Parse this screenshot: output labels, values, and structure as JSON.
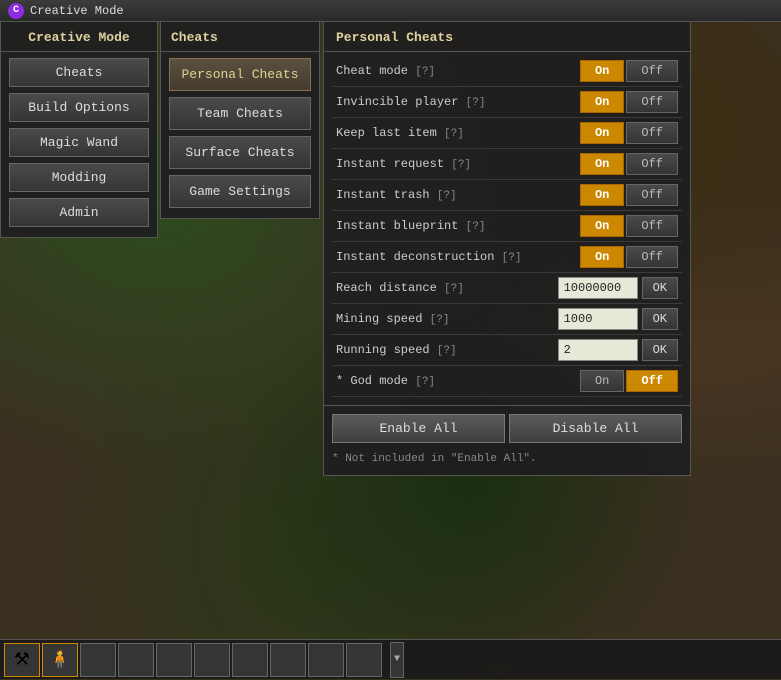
{
  "titlebar": {
    "icon": "C",
    "title": "Creative Mode"
  },
  "left_panel": {
    "title": "Creative Mode",
    "buttons": [
      {
        "id": "cheats",
        "label": "Cheats"
      },
      {
        "id": "build-options",
        "label": "Build Options"
      },
      {
        "id": "magic-wand",
        "label": "Magic Wand"
      },
      {
        "id": "modding",
        "label": "Modding"
      },
      {
        "id": "admin",
        "label": "Admin"
      }
    ]
  },
  "middle_panel": {
    "title": "Cheats",
    "buttons": [
      {
        "id": "personal-cheats",
        "label": "Personal Cheats",
        "active": true
      },
      {
        "id": "team-cheats",
        "label": "Team Cheats"
      },
      {
        "id": "surface-cheats",
        "label": "Surface Cheats"
      },
      {
        "id": "game-settings",
        "label": "Game Settings"
      }
    ]
  },
  "right_panel": {
    "title": "Personal Cheats",
    "settings": [
      {
        "id": "cheat-mode",
        "label": "Cheat mode",
        "help": "[?]",
        "type": "toggle",
        "value": "on"
      },
      {
        "id": "invincible-player",
        "label": "Invincible player",
        "help": "[?]",
        "type": "toggle",
        "value": "on"
      },
      {
        "id": "keep-last-item",
        "label": "Keep last item",
        "help": "[?]",
        "type": "toggle",
        "value": "on"
      },
      {
        "id": "instant-request",
        "label": "Instant request",
        "help": "[?]",
        "type": "toggle",
        "value": "on"
      },
      {
        "id": "instant-trash",
        "label": "Instant trash",
        "help": "[?]",
        "type": "toggle",
        "value": "on"
      },
      {
        "id": "instant-blueprint",
        "label": "Instant blueprint",
        "help": "[?]",
        "type": "toggle",
        "value": "on"
      },
      {
        "id": "instant-deconstruction",
        "label": "Instant deconstruction",
        "help": "[?]",
        "type": "toggle",
        "value": "on"
      },
      {
        "id": "reach-distance",
        "label": "Reach distance",
        "help": "[?]",
        "type": "number",
        "value": "10000000"
      },
      {
        "id": "mining-speed",
        "label": "Mining speed",
        "help": "[?]",
        "type": "number",
        "value": "1000"
      },
      {
        "id": "running-speed",
        "label": "Running speed",
        "help": "[?]",
        "type": "number",
        "value": "2"
      },
      {
        "id": "god-mode",
        "label": "* God mode",
        "help": "[?]",
        "type": "toggle",
        "value": "off"
      }
    ],
    "enable_all": "Enable All",
    "disable_all": "Disable All",
    "footnote": "* Not included in \"Enable All\".",
    "on_label": "On",
    "off_label": "Off",
    "ok_label": "OK"
  },
  "bottombar": {
    "slots": [
      {
        "icon": "⚒",
        "active": true
      },
      {
        "icon": "👤",
        "active": true
      },
      {
        "icon": "",
        "active": false
      },
      {
        "icon": "",
        "active": false
      },
      {
        "icon": "",
        "active": false
      },
      {
        "icon": "",
        "active": false
      },
      {
        "icon": "",
        "active": false
      },
      {
        "icon": "",
        "active": false
      },
      {
        "icon": "",
        "active": false
      },
      {
        "icon": "",
        "active": false
      }
    ],
    "scroll_icon": "▼"
  }
}
